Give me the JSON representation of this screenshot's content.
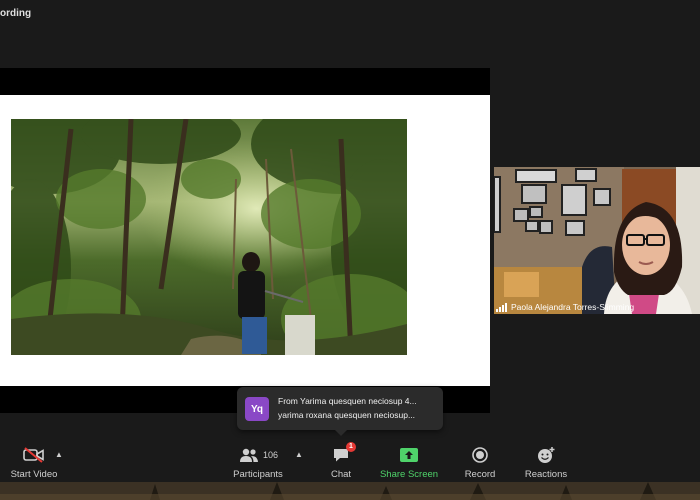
{
  "recording": {
    "label": "ording"
  },
  "participant": {
    "name": "Paola Alejandra Torres-Slimming"
  },
  "chat_notification": {
    "avatar_initials": "Yq",
    "line1": "From Yarima quesquen neciosup 4...",
    "line2": "yarima roxana quesquen neciosup..."
  },
  "toolbar": {
    "start_video": "Start Video",
    "participants": "Participants",
    "participants_count": "106",
    "chat": "Chat",
    "chat_badge": "1",
    "share_screen": "Share Screen",
    "record": "Record",
    "reactions": "Reactions"
  },
  "colors": {
    "share_green": "#4fd36a",
    "avatar_purple": "#8a48c6",
    "badge_red": "#e53935"
  }
}
